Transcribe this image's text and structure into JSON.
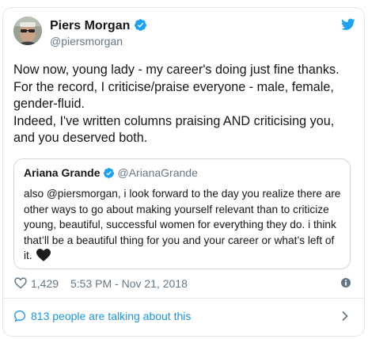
{
  "tweet": {
    "author": {
      "name": "Piers Morgan",
      "handle": "@piersmorgan"
    },
    "text": "Now now, young lady - my career's doing just fine thanks.\nFor the record, I criticise/praise everyone - male, female, gender-fluid.\nIndeed, I've written columns praising AND criticising you, and you deserved both.",
    "quoted": {
      "name": "Ariana Grande",
      "handle": "@ArianaGrande",
      "text": "also @piersmorgan, i look forward to the day you realize there are other ways to go about making yourself relevant than to criticize young, beautiful, successful women for everything they do. i think that’ll be a beautiful thing for you and your career or what’s left of it."
    },
    "likes": "1,429",
    "timestamp": "5:53 PM - Nov 21, 2018"
  },
  "footer": {
    "talking_text": "813 people are talking about this"
  },
  "colors": {
    "twitter_blue": "#1da1f2",
    "link_blue": "#1b95e0",
    "muted": "#657786",
    "border": "#e1e8ed"
  },
  "icons": [
    "verified-icon",
    "twitter-bird-icon",
    "heart-icon",
    "info-icon",
    "speech-bubble-icon",
    "chevron-right-icon",
    "black-heart-emoji"
  ]
}
